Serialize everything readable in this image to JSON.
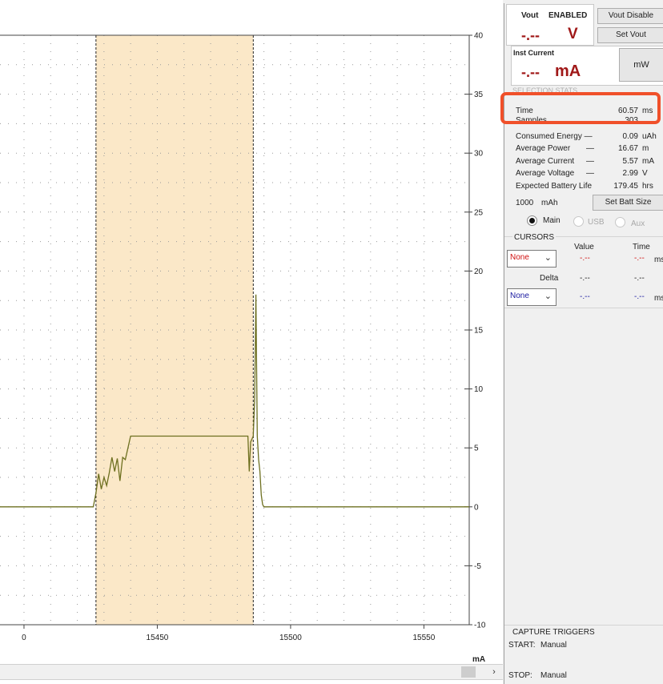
{
  "vout": {
    "label": "Vout",
    "status": "ENABLED",
    "value": "-.--",
    "unit": "V",
    "disable_button": "Vout Disable",
    "set_button": "Set Vout"
  },
  "inst_current": {
    "label": "Inst Current",
    "value": "-.--",
    "unit": "mA",
    "mw_button": "mW"
  },
  "selection_stats": {
    "header": "SELECTION STATS",
    "rows": [
      {
        "label": "Time",
        "value": "60.57",
        "unit": "ms"
      },
      {
        "label": "Samples",
        "value": "303",
        "unit": ""
      },
      {
        "label": "Consumed Energy —",
        "value": "0.09",
        "unit": "uAh"
      },
      {
        "label": "Average Power",
        "value": "16.67",
        "unit": "m",
        "dash": "—"
      },
      {
        "label": "Average Current",
        "value": "5.57",
        "unit": "mA",
        "dash": "—"
      },
      {
        "label": "Average Voltage",
        "value": "2.99",
        "unit": "V",
        "dash": "—"
      },
      {
        "label": "Expected Battery Life",
        "value": "179.45",
        "unit": "hrs"
      }
    ],
    "battery_size": "1000",
    "battery_unit": "mAh",
    "set_batt_button": "Set Batt Size",
    "channels": [
      {
        "label": "Main",
        "selected": true
      },
      {
        "label": "USB",
        "selected": false
      },
      {
        "label": "Aux",
        "selected": false
      }
    ]
  },
  "cursors": {
    "header": "CURSORS",
    "col_value": "Value",
    "col_time": "Time",
    "cursor1": {
      "select": "None",
      "value": "-.--",
      "time": "-.--",
      "unit": "ms",
      "color": "#d01010"
    },
    "delta": {
      "label": "Delta",
      "value": "-.--",
      "time": "-.--"
    },
    "cursor2": {
      "select": "None",
      "value": "-.--",
      "time": "-.--",
      "unit": "ms",
      "color": "#1a1aa0"
    }
  },
  "triggers": {
    "header": "CAPTURE TRIGGERS",
    "start_label": "START:",
    "start_value": "Manual",
    "stop_label": "STOP:",
    "stop_value": "Manual"
  },
  "chart_data": {
    "type": "line",
    "ylabel_unit": "mA",
    "ylim": [
      -10,
      40
    ],
    "yticks": [
      -10,
      -5,
      0,
      5,
      10,
      15,
      20,
      25,
      30,
      35,
      40
    ],
    "xlim": [
      15391,
      15567
    ],
    "xticks": [
      15400,
      15450,
      15500,
      15550
    ],
    "xtick_labels": [
      "0",
      "15450",
      "15500",
      "15550"
    ],
    "selection": {
      "x_start": 15427,
      "x_end": 15486,
      "color": "#fbe8c8"
    },
    "grid": true,
    "series": [
      {
        "color": "#6e7020",
        "x": [
          15391,
          15426,
          15427,
          15428,
          15429,
          15430,
          15431,
          15432,
          15433,
          15434,
          15435,
          15436,
          15437,
          15438,
          15440,
          15442,
          15460,
          15475,
          15484,
          15484.5,
          15485,
          15486,
          15486.5,
          15487,
          15487.5,
          15488,
          15488.5,
          15489,
          15489.5,
          15490,
          15500,
          15567
        ],
        "y": [
          0,
          0,
          1.2,
          2.8,
          1.5,
          2.5,
          1.8,
          2.9,
          4.2,
          3.0,
          4.1,
          2.2,
          4.2,
          4.0,
          6.0,
          6.0,
          6.0,
          6.0,
          6.0,
          3.0,
          5.5,
          6.0,
          9.0,
          18.0,
          6.0,
          4.0,
          3.0,
          1.0,
          0.2,
          0,
          0,
          0
        ]
      }
    ]
  }
}
